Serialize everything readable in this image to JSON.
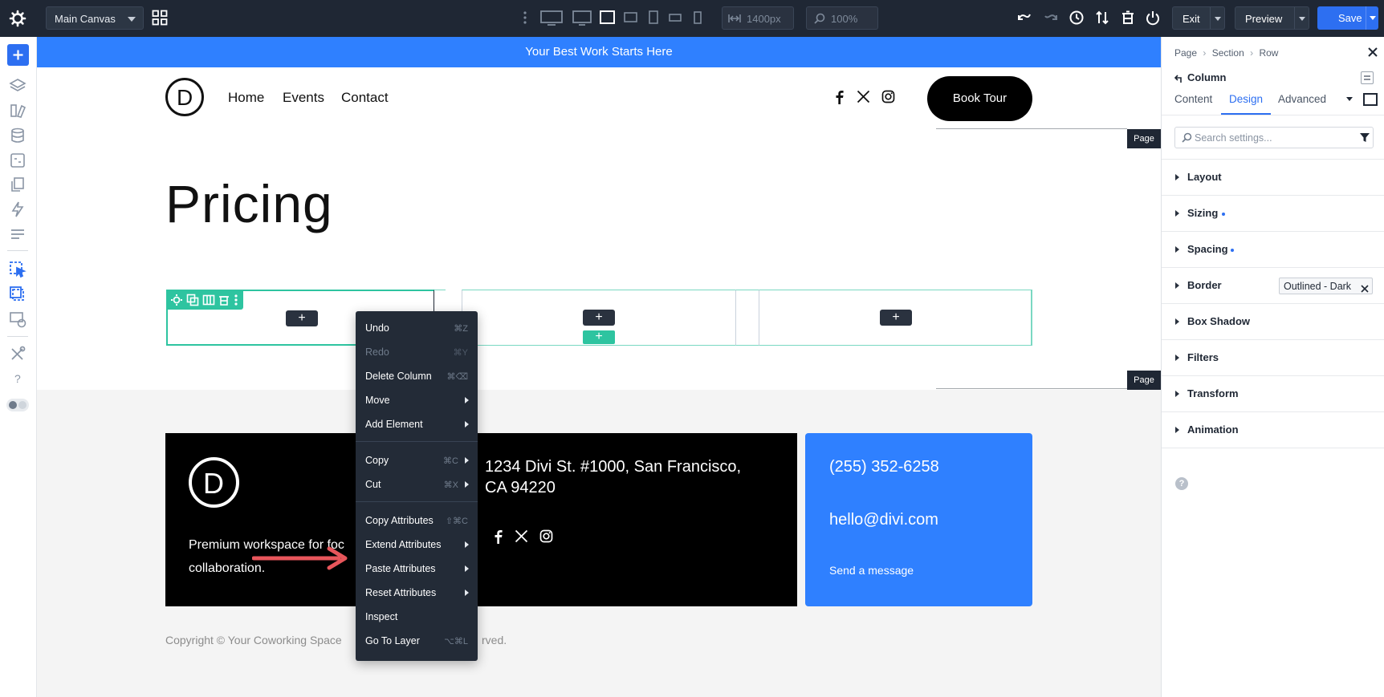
{
  "topbar": {
    "canvas_select": "Main Canvas",
    "width_value": "1400px",
    "zoom_value": "100%",
    "exit_label": "Exit",
    "preview_label": "Preview",
    "save_label": "Save"
  },
  "canvas": {
    "banner": "Your Best Work Starts Here",
    "logo_letter": "D",
    "nav": [
      "Home",
      "Events",
      "Contact"
    ],
    "book_button": "Book Tour",
    "heading": "Pricing",
    "page_badge": "Page",
    "footer": {
      "tagline_line1": "Premium workspace for foc",
      "tagline_line2": "collaboration.",
      "address_line1": "1234 Divi St. #1000, San Francisco,",
      "address_line2": "CA 94220",
      "phone": "(255) 352-6258",
      "email": "hello@divi.com",
      "send": "Send a message",
      "copyright_left": "Copyright © Your Coworking Space",
      "copyright_right": "rved."
    }
  },
  "context_menu": {
    "items": [
      {
        "label": "Undo",
        "shortcut": "⌘Z"
      },
      {
        "label": "Redo",
        "shortcut": "⌘Y"
      },
      {
        "label": "Delete Column",
        "shortcut": "⌘⌫"
      },
      {
        "label": "Move"
      },
      {
        "label": "Add Element"
      },
      {
        "label": "Copy",
        "shortcut": "⌘C"
      },
      {
        "label": "Cut",
        "shortcut": "⌘X"
      },
      {
        "label": "Copy Attributes",
        "shortcut": "⇧⌘C"
      },
      {
        "label": "Extend Attributes"
      },
      {
        "label": "Paste Attributes"
      },
      {
        "label": "Reset Attributes"
      },
      {
        "label": "Inspect"
      },
      {
        "label": "Go To Layer",
        "shortcut": "⌥⌘L"
      }
    ]
  },
  "panel": {
    "breadcrumb": [
      "Page",
      "Section",
      "Row"
    ],
    "title": "Column",
    "tabs": [
      "Content",
      "Design",
      "Advanced"
    ],
    "active_tab": "Design",
    "search_placeholder": "Search settings...",
    "sections": [
      "Layout",
      "Sizing",
      "Spacing",
      "Border",
      "Box Shadow",
      "Filters",
      "Transform",
      "Animation"
    ],
    "border_preset": "Outlined - Dark"
  },
  "colors": {
    "topbar": "#1f2734",
    "accent": "#2d6ff1",
    "banner": "#2f80ff",
    "column_outline": "#2ec4a0",
    "arrow": "#e8565b"
  }
}
